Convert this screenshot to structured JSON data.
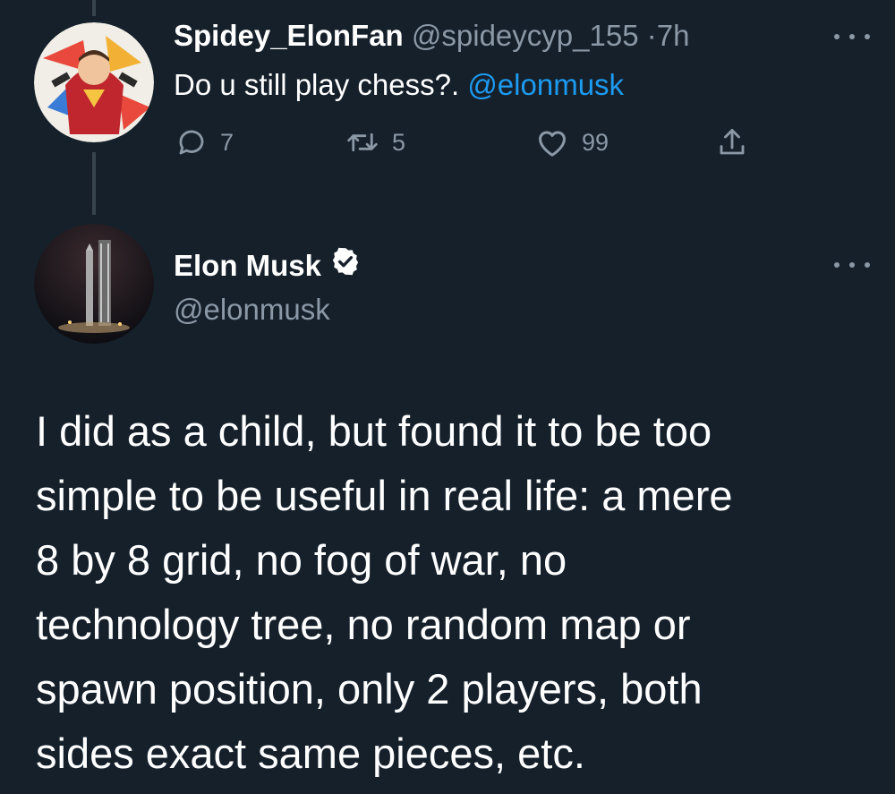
{
  "reply_to_tweet": {
    "display_name": "Spidey_ElonFan",
    "handle": "@spideycyp_155",
    "separator": "·",
    "time": "7h",
    "text": "Do u still play chess?.",
    "mention": "@elonmusk",
    "actions": {
      "replies": "7",
      "retweets": "5",
      "likes": "99"
    },
    "icons": [
      "reply-icon",
      "retweet-icon",
      "like-icon",
      "share-icon",
      "more-icon"
    ]
  },
  "main_tweet": {
    "display_name": "Elon Musk",
    "handle": "@elonmusk",
    "verified": true,
    "text_lines": [
      "I did as a child, but found it to be too",
      "simple to be useful in real life: a mere",
      "8 by 8 grid, no fog of war, no",
      "technology tree, no random map or",
      "spawn position, only 2 players, both",
      "sides exact same pieces, etc."
    ]
  },
  "colors": {
    "background": "#15202b",
    "text": "#ffffff",
    "secondary": "#8b98a5",
    "accent": "#1d9bf0",
    "thread_line": "#38444d"
  }
}
